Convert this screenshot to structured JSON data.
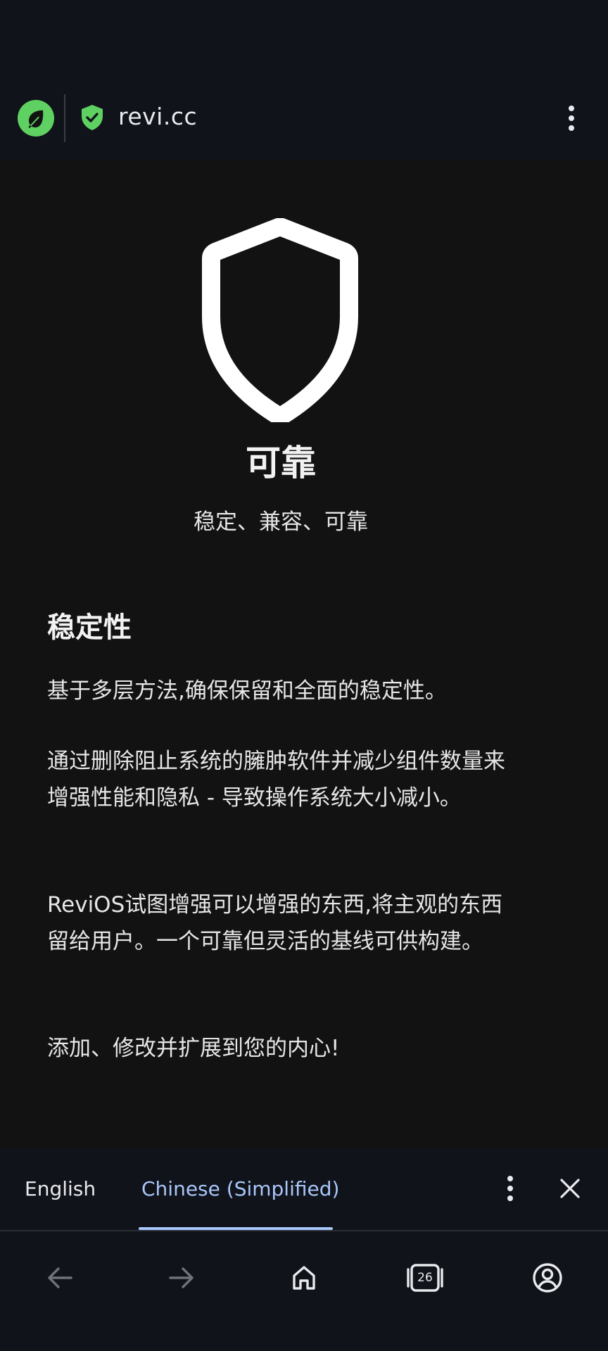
{
  "browser": {
    "url": "revi.cc"
  },
  "page": {
    "hero_title": "可靠",
    "hero_subtitle": "稳定、兼容、可靠",
    "section_title": "稳定性",
    "paragraphs": [
      "基于多层方法,确保保留和全面的稳定性。",
      "通过删除阻止系统的臃肿软件并减少组件数量来增强性能和隐私 - 导致操作系统大小减小。",
      "ReviOS试图增强可以增强的东西,将主观的东西留给用户。一个可靠但灵活的基线可供构建。",
      "添加、修改并扩展到您的内心!"
    ]
  },
  "translate_bar": {
    "source_language": "English",
    "target_language": "Chinese (Simplified)"
  },
  "bottom_nav": {
    "tab_count": "26"
  },
  "icons": {
    "site_badge": "leaf-icon",
    "secure": "shield-check-icon",
    "menu": "more-vert-icon",
    "hero": "shield-outline-icon",
    "close": "close-icon",
    "back": "arrow-back-icon",
    "forward": "arrow-forward-icon",
    "home": "home-icon",
    "tabs": "tab-switcher-icon",
    "account": "account-circle-icon"
  },
  "colors": {
    "site_badge": "#5fd162",
    "accent": "#a8c7fa",
    "background": "#121212",
    "toolbar": "#11131a"
  }
}
